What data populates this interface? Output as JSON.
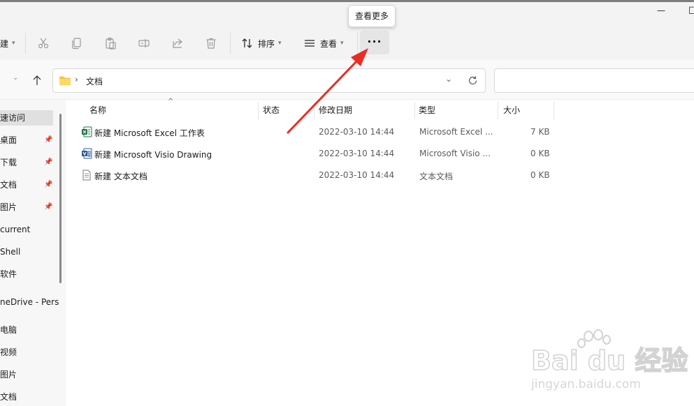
{
  "window": {
    "minimize_glyph": "—",
    "maximize_glyph": "☐"
  },
  "toolbar": {
    "new_fragment": "建",
    "sort_label": "排序",
    "view_label": "查看",
    "more_glyph": "···",
    "tooltip": "查看更多",
    "icons": [
      "cut-icon",
      "copy-icon",
      "paste-icon",
      "rename-icon",
      "share-icon",
      "delete-icon",
      "sort-icon",
      "view-icon",
      "more-icon"
    ]
  },
  "navigation": {
    "breadcrumb_separator": "›",
    "current_folder": "文档",
    "search_placeholder": ""
  },
  "sidebar": {
    "items": [
      {
        "label": "速访问",
        "pinned": false,
        "selected": true
      },
      {
        "label": "桌面",
        "pinned": true
      },
      {
        "label": "下载",
        "pinned": true
      },
      {
        "label": "文档",
        "pinned": true
      },
      {
        "label": "图片",
        "pinned": true
      },
      {
        "label": "current",
        "pinned": false
      },
      {
        "label": "Shell",
        "pinned": false
      },
      {
        "label": "软件",
        "pinned": false
      },
      {
        "label": "neDrive - Pers",
        "pinned": false
      },
      {
        "label": "电脑",
        "pinned": false
      },
      {
        "label": "视频",
        "pinned": false
      },
      {
        "label": "图片",
        "pinned": false
      },
      {
        "label": "文档",
        "pinned": false
      }
    ]
  },
  "columns": {
    "name": "名称",
    "status": "状态",
    "modified": "修改日期",
    "type": "类型",
    "size": "大小"
  },
  "files": [
    {
      "name": "新建 Microsoft Excel 工作表",
      "modified": "2022-03-10 14:44",
      "type": "Microsoft Excel ...",
      "size": "7 KB",
      "icon": "excel-file-icon",
      "color": "#1d6f42"
    },
    {
      "name": "新建 Microsoft Visio Drawing",
      "modified": "2022-03-10 14:44",
      "type": "Microsoft Visio ...",
      "size": "0 KB",
      "icon": "visio-file-icon",
      "color": "#2b579a"
    },
    {
      "name": "新建 文本文档",
      "modified": "2022-03-10 14:44",
      "type": "文本文档",
      "size": "0 KB",
      "icon": "text-file-icon",
      "color": "#6b6b6b"
    }
  ],
  "annotation": {
    "arrow_color": "#ee2a24"
  },
  "watermark": {
    "brand": "Bai du 经验",
    "url": "jingyan.baidu.com"
  }
}
